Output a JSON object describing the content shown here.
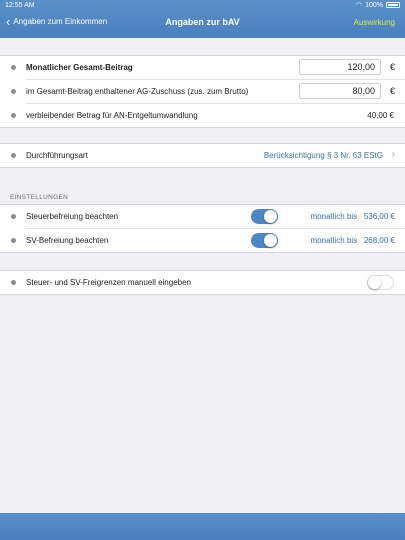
{
  "status": {
    "time": "12:55 AM",
    "battery": "100%"
  },
  "nav": {
    "back_label": "Angaben zum Einkommen",
    "title": "Angaben zur bAV",
    "action_label": "Auswirkung"
  },
  "beitrag": {
    "gesamt_label": "Monatlicher Gesamt-Beitrag",
    "gesamt_value": "120,00",
    "ag_label": "im Gesamt-Beitrag enthaltener AG-Zuschuss (zus. zum Brutto)",
    "ag_value": "80,00",
    "rest_label": "verbleibender Betrag für AN-Entgeltumwandlung",
    "rest_value": "40,00 €",
    "unit": "€"
  },
  "durchfuehrung": {
    "label": "Durchführungsart",
    "value": "Berücksichtigung § 3 Nr. 63 EStG"
  },
  "einstellungen": {
    "header": "EINSTELLUNGEN",
    "steuer_label": "Steuerbefreiung beachten",
    "steuer_prefix": "monatlich bis",
    "steuer_amount": "536,00 €",
    "steuer_on": true,
    "sv_label": "SV-Befreiung beachten",
    "sv_prefix": "monatlich bis",
    "sv_amount": "268,00 €",
    "sv_on": true
  },
  "manuell": {
    "label": "Steuer- und SV-Freigrenzen manuell eingeben",
    "on": false
  },
  "colors": {
    "accent": "#4d87c4",
    "bar": "#4a80bf",
    "action": "#d9e84a"
  }
}
